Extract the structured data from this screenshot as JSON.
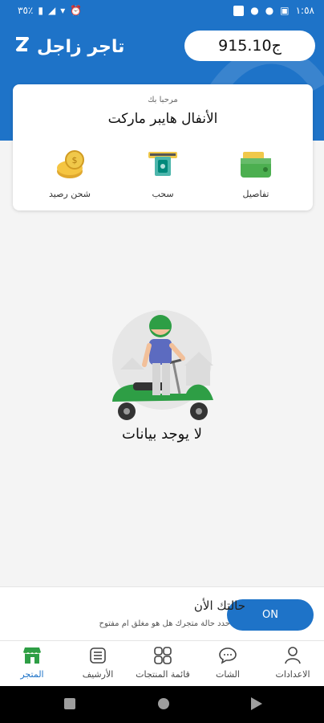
{
  "status_bar": {
    "time": "١:٥٨",
    "battery": "٣٥٪"
  },
  "header": {
    "title": "تاجر زاجل",
    "balance": "915.10ج"
  },
  "card": {
    "greeting": "مرحبا بك",
    "store_name": "الأنفال هايبر ماركت",
    "actions": [
      {
        "label": "تفاصيل",
        "icon": "wallet-icon"
      },
      {
        "label": "سحب",
        "icon": "atm-withdraw-icon"
      },
      {
        "label": "شحن رصيد",
        "icon": "coins-icon"
      }
    ]
  },
  "empty": {
    "message": "لا يوجد بيانات"
  },
  "store_status": {
    "title": "حالتك الأن",
    "subtitle": "حدد حالة متجرك هل هو مغلق ام مفتوح",
    "toggle_label": "ON"
  },
  "bottom_nav": {
    "items": [
      {
        "label": "الاعدادات",
        "icon": "person-icon"
      },
      {
        "label": "الشات",
        "icon": "chat-icon"
      },
      {
        "label": "قائمة المنتجات",
        "icon": "grid-icon"
      },
      {
        "label": "الأرشيف",
        "icon": "list-icon"
      },
      {
        "label": "المتجر",
        "icon": "store-icon"
      }
    ],
    "active": "المتجر"
  },
  "colors": {
    "primary": "#1e73c8",
    "accent_green": "#2e9e45"
  }
}
